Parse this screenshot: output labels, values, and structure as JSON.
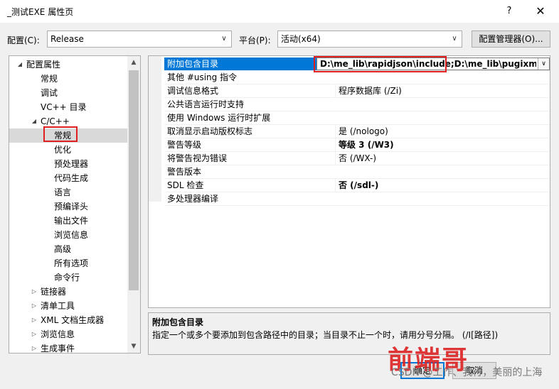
{
  "window": {
    "title": "_测试EXE 属性页",
    "help": "?",
    "close": "✕"
  },
  "toolbar": {
    "config_label": "配置(C):",
    "config_value": "Release",
    "platform_label": "平台(P):",
    "platform_value": "活动(x64)",
    "config_manager": "配置管理器(O)..."
  },
  "tree": {
    "items": [
      {
        "label": "配置属性",
        "expander": "◢"
      },
      {
        "label": "常规"
      },
      {
        "label": "调试"
      },
      {
        "label": "VC++ 目录"
      },
      {
        "label": "C/C++",
        "expander": "◢"
      },
      {
        "label": "常规"
      },
      {
        "label": "优化"
      },
      {
        "label": "预处理器"
      },
      {
        "label": "代码生成"
      },
      {
        "label": "语言"
      },
      {
        "label": "预编译头"
      },
      {
        "label": "输出文件"
      },
      {
        "label": "浏览信息"
      },
      {
        "label": "高级"
      },
      {
        "label": "所有选项"
      },
      {
        "label": "命令行"
      },
      {
        "label": "链接器",
        "expander": "▷"
      },
      {
        "label": "清单工具",
        "expander": "▷"
      },
      {
        "label": "XML 文档生成器",
        "expander": "▷"
      },
      {
        "label": "浏览信息",
        "expander": "▷"
      },
      {
        "label": "生成事件",
        "expander": "▷"
      }
    ]
  },
  "properties": [
    {
      "name": "附加包含目录",
      "value": "D:\\me_lib\\rapidjson\\include;D:\\me_lib\\pugixml\\src",
      "bold": true
    },
    {
      "name": "其他 #using 指令",
      "value": ""
    },
    {
      "name": "调试信息格式",
      "value": "程序数据库 (/Zi)"
    },
    {
      "name": "公共语言运行时支持",
      "value": ""
    },
    {
      "name": "使用 Windows 运行时扩展",
      "value": ""
    },
    {
      "name": "取消显示启动版权标志",
      "value": "是 (/nologo)"
    },
    {
      "name": "警告等级",
      "value": "等级 3 (/W3)",
      "bold": true
    },
    {
      "name": "将警告视为错误",
      "value": "否 (/WX-)"
    },
    {
      "name": "警告版本",
      "value": ""
    },
    {
      "name": "SDL 检查",
      "value": "否 (/sdl-)",
      "bold": true
    },
    {
      "name": "多处理器编译",
      "value": ""
    }
  ],
  "description": {
    "title": "附加包含目录",
    "text": "指定一个或多个要添加到包含路径中的目录；当目录不止一个时，请用分号分隔。       (/I[路径])"
  },
  "buttons": {
    "ok": "确定",
    "cancel": "取消"
  },
  "watermark": {
    "text": "前端哥",
    "csdn": "CSDN @工作、我行，美丽的上海"
  },
  "colors": {
    "selection": "#0078d7",
    "highlight_box": "#e02020"
  }
}
